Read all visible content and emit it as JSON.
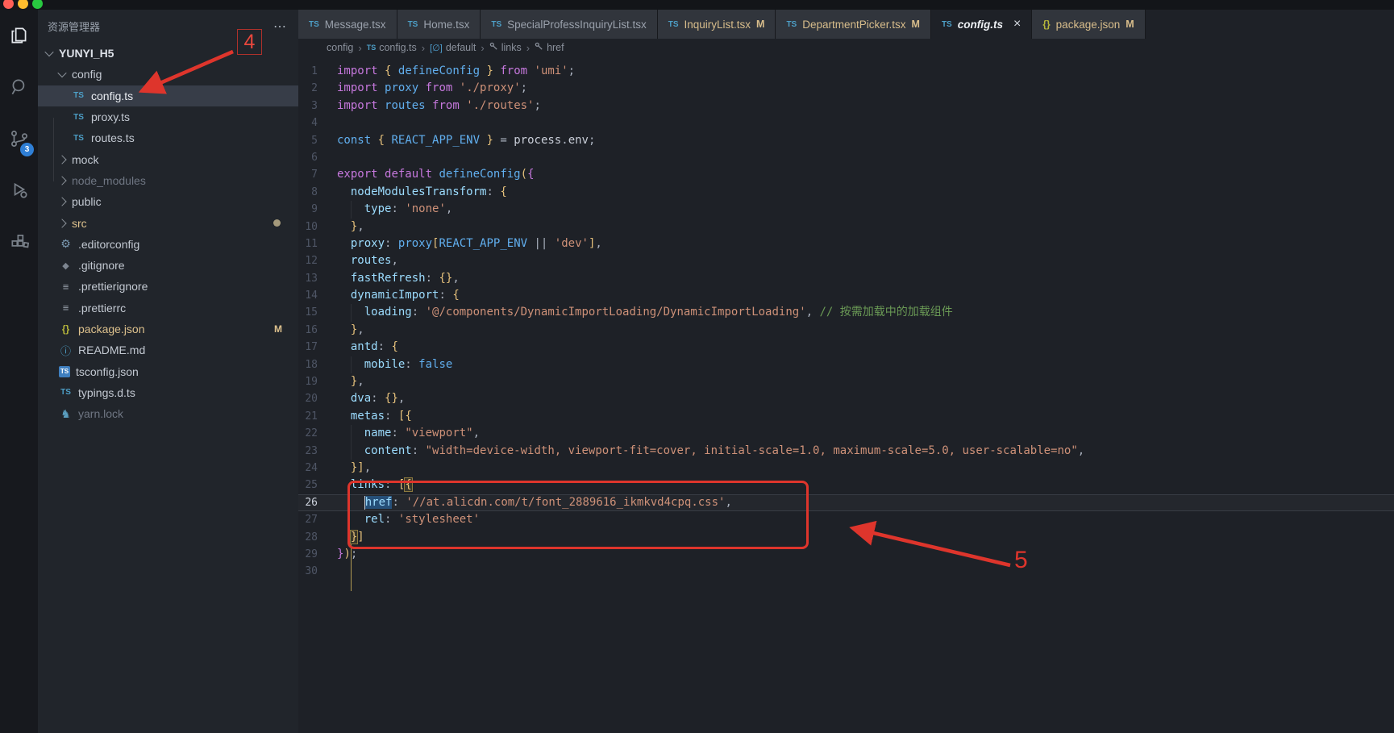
{
  "window": {
    "traffic_lights": [
      "#ff5f57",
      "#febc2e",
      "#28c840"
    ]
  },
  "activity_bar": {
    "items": [
      {
        "name": "explorer",
        "active": true
      },
      {
        "name": "search",
        "active": false
      },
      {
        "name": "source-control",
        "active": false,
        "badge": "3"
      },
      {
        "name": "run-debug",
        "active": false
      },
      {
        "name": "extensions",
        "active": false
      }
    ]
  },
  "sidebar": {
    "title": "资源管理器",
    "more_label": "⋯",
    "items": [
      {
        "label": "YUNYI_H5",
        "icon": "chevron-down",
        "indent": 0,
        "bold": true
      },
      {
        "label": "config",
        "icon": "chevron-down",
        "indent": 1
      },
      {
        "label": "config.ts",
        "icon": "ts",
        "indent": 2,
        "selected": true
      },
      {
        "label": "proxy.ts",
        "icon": "ts",
        "indent": 2
      },
      {
        "label": "routes.ts",
        "icon": "ts",
        "indent": 2
      },
      {
        "label": "mock",
        "icon": "chevron-right",
        "indent": 1
      },
      {
        "label": "node_modules",
        "icon": "chevron-right",
        "indent": 1,
        "dim": true
      },
      {
        "label": "public",
        "icon": "chevron-right",
        "indent": 1
      },
      {
        "label": "src",
        "icon": "chevron-right",
        "indent": 1,
        "tan": true,
        "badge": "dot"
      },
      {
        "label": ".editorconfig",
        "icon": "gear",
        "indent": 1
      },
      {
        "label": ".gitignore",
        "icon": "git",
        "indent": 1
      },
      {
        "label": ".prettierignore",
        "icon": "lines",
        "indent": 1
      },
      {
        "label": ".prettierrc",
        "icon": "lines",
        "indent": 1
      },
      {
        "label": "package.json",
        "icon": "braces",
        "indent": 1,
        "tan": true,
        "badge": "M"
      },
      {
        "label": "README.md",
        "icon": "info",
        "indent": 1
      },
      {
        "label": "tsconfig.json",
        "icon": "tsbox",
        "indent": 1
      },
      {
        "label": "typings.d.ts",
        "icon": "ts",
        "indent": 1
      },
      {
        "label": "yarn.lock",
        "icon": "yarn",
        "indent": 1,
        "dim": true
      }
    ]
  },
  "tabs": [
    {
      "label": "Message.tsx",
      "icon": "ts"
    },
    {
      "label": "Home.tsx",
      "icon": "ts"
    },
    {
      "label": "SpecialProfessInquiryList.tsx",
      "icon": "ts"
    },
    {
      "label": "InquiryList.tsx",
      "icon": "ts",
      "modified": "M"
    },
    {
      "label": "DepartmentPicker.tsx",
      "icon": "ts",
      "modified": "M"
    },
    {
      "label": "config.ts",
      "icon": "ts",
      "active": true,
      "close": "×"
    },
    {
      "label": "package.json",
      "icon": "braces",
      "modified": "M"
    }
  ],
  "breadcrumb": [
    {
      "label": "config"
    },
    {
      "label": "config.ts",
      "icon": "ts"
    },
    {
      "label": "default",
      "icon": "module"
    },
    {
      "label": "links",
      "icon": "wrench"
    },
    {
      "label": "href",
      "icon": "wrench"
    }
  ],
  "glyphs": {
    "ts": "TS",
    "braces": "{}",
    "gear": "⚙",
    "git": "◆",
    "lines": "≡",
    "info": "ⓘ",
    "yarn": "♞",
    "tsbox": "TS",
    "module": "[∅]",
    "close": "×",
    "more": "⋯"
  },
  "editor": {
    "active_line": 26,
    "lines": [
      {
        "n": 1,
        "t": [
          [
            "import",
            "kw"
          ],
          [
            " ",
            "pln"
          ],
          [
            "{",
            "brk"
          ],
          [
            " ",
            "pln"
          ],
          [
            "defineConfig",
            "id"
          ],
          [
            " ",
            "pln"
          ],
          [
            "}",
            "brk"
          ],
          [
            " ",
            "pln"
          ],
          [
            "from",
            "kw"
          ],
          [
            " ",
            "pln"
          ],
          [
            "'umi'",
            "str"
          ],
          [
            ";",
            "pun"
          ]
        ]
      },
      {
        "n": 2,
        "t": [
          [
            "import",
            "kw"
          ],
          [
            " ",
            "pln"
          ],
          [
            "proxy",
            "id"
          ],
          [
            " ",
            "pln"
          ],
          [
            "from",
            "kw"
          ],
          [
            " ",
            "pln"
          ],
          [
            "'./proxy'",
            "str"
          ],
          [
            ";",
            "pun"
          ]
        ]
      },
      {
        "n": 3,
        "t": [
          [
            "import",
            "kw"
          ],
          [
            " ",
            "pln"
          ],
          [
            "routes",
            "id"
          ],
          [
            " ",
            "pln"
          ],
          [
            "from",
            "kw"
          ],
          [
            " ",
            "pln"
          ],
          [
            "'./routes'",
            "str"
          ],
          [
            ";",
            "pun"
          ]
        ]
      },
      {
        "n": 4,
        "t": []
      },
      {
        "n": 5,
        "t": [
          [
            "const",
            "id"
          ],
          [
            " ",
            "pln"
          ],
          [
            "{",
            "brk"
          ],
          [
            " ",
            "pln"
          ],
          [
            "REACT_APP_ENV",
            "id"
          ],
          [
            " ",
            "pln"
          ],
          [
            "}",
            "brk"
          ],
          [
            " ",
            "pln"
          ],
          [
            "=",
            "pun"
          ],
          [
            " ",
            "pln"
          ],
          [
            "process",
            "pln"
          ],
          [
            ".",
            "pun"
          ],
          [
            "env",
            "pln"
          ],
          [
            ";",
            "pun"
          ]
        ]
      },
      {
        "n": 6,
        "t": []
      },
      {
        "n": 7,
        "t": [
          [
            "export",
            "kw"
          ],
          [
            " ",
            "pln"
          ],
          [
            "default",
            "kw"
          ],
          [
            " ",
            "pln"
          ],
          [
            "defineConfig",
            "id"
          ],
          [
            "(",
            "brk"
          ],
          [
            "{",
            "brkp"
          ]
        ]
      },
      {
        "n": 8,
        "t": [
          [
            "  ",
            "pln"
          ],
          [
            "nodeModulesTransform",
            "prop"
          ],
          [
            ":",
            "pun"
          ],
          [
            " ",
            "pln"
          ],
          [
            "{",
            "brk"
          ]
        ]
      },
      {
        "n": 9,
        "t": [
          [
            "    ",
            "pln"
          ],
          [
            "type",
            "prop"
          ],
          [
            ":",
            "pun"
          ],
          [
            " ",
            "pln"
          ],
          [
            "'none'",
            "str"
          ],
          [
            ",",
            "pun"
          ]
        ]
      },
      {
        "n": 10,
        "t": [
          [
            "  ",
            "pln"
          ],
          [
            "}",
            "brk"
          ],
          [
            ",",
            "pun"
          ]
        ]
      },
      {
        "n": 11,
        "t": [
          [
            "  ",
            "pln"
          ],
          [
            "proxy",
            "prop"
          ],
          [
            ":",
            "pun"
          ],
          [
            " ",
            "pln"
          ],
          [
            "proxy",
            "id"
          ],
          [
            "[",
            "brk"
          ],
          [
            "REACT_APP_ENV",
            "id"
          ],
          [
            " ",
            "pln"
          ],
          [
            "||",
            "pun"
          ],
          [
            " ",
            "pln"
          ],
          [
            "'dev'",
            "str"
          ],
          [
            "]",
            "brk"
          ],
          [
            ",",
            "pun"
          ]
        ]
      },
      {
        "n": 12,
        "t": [
          [
            "  ",
            "pln"
          ],
          [
            "routes",
            "prop"
          ],
          [
            ",",
            "pun"
          ]
        ]
      },
      {
        "n": 13,
        "t": [
          [
            "  ",
            "pln"
          ],
          [
            "fastRefresh",
            "prop"
          ],
          [
            ":",
            "pun"
          ],
          [
            " ",
            "pln"
          ],
          [
            "{}",
            "brk"
          ],
          [
            ",",
            "pun"
          ]
        ]
      },
      {
        "n": 14,
        "t": [
          [
            "  ",
            "pln"
          ],
          [
            "dynamicImport",
            "prop"
          ],
          [
            ":",
            "pun"
          ],
          [
            " ",
            "pln"
          ],
          [
            "{",
            "brk"
          ]
        ]
      },
      {
        "n": 15,
        "t": [
          [
            "    ",
            "pln"
          ],
          [
            "loading",
            "prop"
          ],
          [
            ":",
            "pun"
          ],
          [
            " ",
            "pln"
          ],
          [
            "'@/components/DynamicImportLoading/DynamicImportLoading'",
            "str"
          ],
          [
            ",",
            "pun"
          ],
          [
            " ",
            "pln"
          ],
          [
            "// 按需加载中的加载组件",
            "cmt"
          ]
        ]
      },
      {
        "n": 16,
        "t": [
          [
            "  ",
            "pln"
          ],
          [
            "}",
            "brk"
          ],
          [
            ",",
            "pun"
          ]
        ]
      },
      {
        "n": 17,
        "t": [
          [
            "  ",
            "pln"
          ],
          [
            "antd",
            "prop"
          ],
          [
            ":",
            "pun"
          ],
          [
            " ",
            "pln"
          ],
          [
            "{",
            "brk"
          ]
        ]
      },
      {
        "n": 18,
        "t": [
          [
            "    ",
            "pln"
          ],
          [
            "mobile",
            "prop"
          ],
          [
            ":",
            "pun"
          ],
          [
            " ",
            "pln"
          ],
          [
            "false",
            "id"
          ]
        ]
      },
      {
        "n": 19,
        "t": [
          [
            "  ",
            "pln"
          ],
          [
            "}",
            "brk"
          ],
          [
            ",",
            "pun"
          ]
        ]
      },
      {
        "n": 20,
        "t": [
          [
            "  ",
            "pln"
          ],
          [
            "dva",
            "prop"
          ],
          [
            ":",
            "pun"
          ],
          [
            " ",
            "pln"
          ],
          [
            "{}",
            "brk"
          ],
          [
            ",",
            "pun"
          ]
        ]
      },
      {
        "n": 21,
        "t": [
          [
            "  ",
            "pln"
          ],
          [
            "metas",
            "prop"
          ],
          [
            ":",
            "pun"
          ],
          [
            " ",
            "pln"
          ],
          [
            "[{",
            "brk"
          ]
        ]
      },
      {
        "n": 22,
        "t": [
          [
            "    ",
            "pln"
          ],
          [
            "name",
            "prop"
          ],
          [
            ":",
            "pun"
          ],
          [
            " ",
            "pln"
          ],
          [
            "\"viewport\"",
            "str"
          ],
          [
            ",",
            "pun"
          ]
        ]
      },
      {
        "n": 23,
        "t": [
          [
            "    ",
            "pln"
          ],
          [
            "content",
            "prop"
          ],
          [
            ":",
            "pun"
          ],
          [
            " ",
            "pln"
          ],
          [
            "\"width=device-width, viewport-fit=cover, initial-scale=1.0, maximum-scale=5.0, user-scalable=no\"",
            "str"
          ],
          [
            ",",
            "pun"
          ]
        ]
      },
      {
        "n": 24,
        "t": [
          [
            "  ",
            "pln"
          ],
          [
            "}]",
            "brk"
          ],
          [
            ",",
            "pun"
          ]
        ]
      },
      {
        "n": 25,
        "t": [
          [
            "  ",
            "pln"
          ],
          [
            "links",
            "prop"
          ],
          [
            ":",
            "pun"
          ],
          [
            " ",
            "pln"
          ],
          [
            "[",
            "brk"
          ],
          [
            "{",
            "brk bm"
          ]
        ]
      },
      {
        "n": 26,
        "t": [
          [
            "    ",
            "pln"
          ],
          [
            "",
            "caret"
          ],
          [
            "href",
            "prop hl"
          ],
          [
            ":",
            "pun"
          ],
          [
            " ",
            "pln"
          ],
          [
            "'//at.alicdn.com/t/font_2889616_ikmkvd4cpq.css'",
            "str"
          ],
          [
            ",",
            "pun"
          ]
        ]
      },
      {
        "n": 27,
        "t": [
          [
            "    ",
            "pln"
          ],
          [
            "rel",
            "prop"
          ],
          [
            ":",
            "pun"
          ],
          [
            " ",
            "pln"
          ],
          [
            "'stylesheet'",
            "str"
          ]
        ]
      },
      {
        "n": 28,
        "t": [
          [
            "  ",
            "pln"
          ],
          [
            "}",
            "brk bm"
          ],
          [
            "]",
            "brk"
          ]
        ]
      },
      {
        "n": 29,
        "t": [
          [
            "}",
            "brkp"
          ],
          [
            ")",
            "brk"
          ],
          [
            ";",
            "pun"
          ]
        ]
      },
      {
        "n": 30,
        "t": []
      }
    ]
  },
  "annotations": {
    "step4_label": "4",
    "step5_label": "5",
    "accent_color": "#de352c"
  }
}
